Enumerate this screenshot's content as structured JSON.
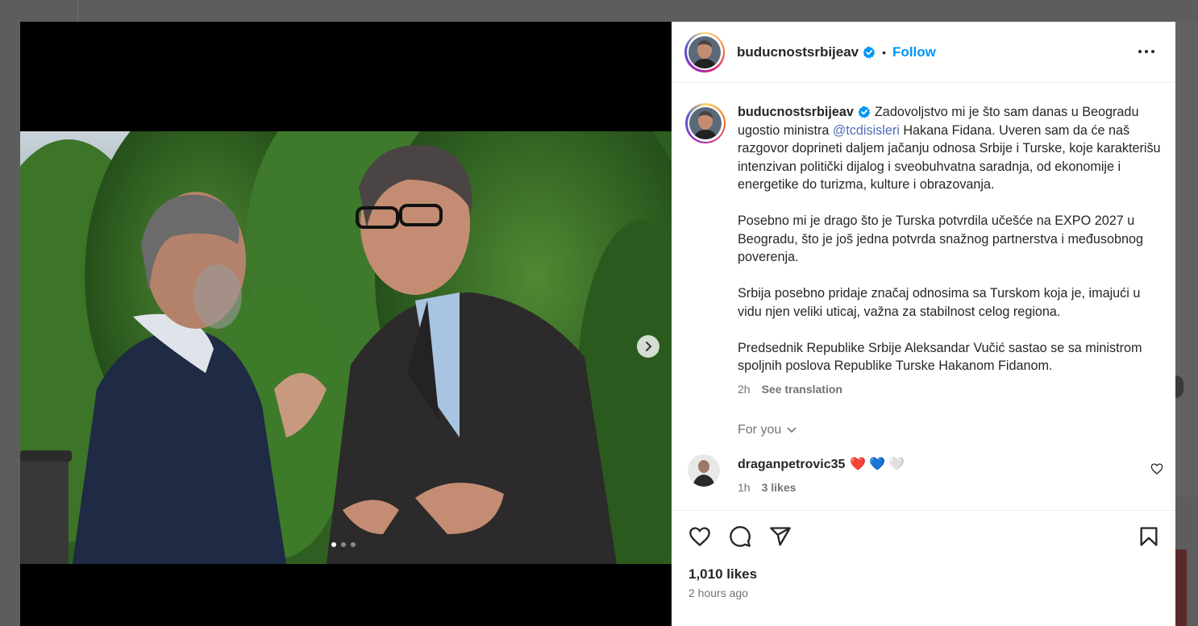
{
  "post": {
    "username": "buducnostsrbijeav",
    "separator": "•",
    "follow_label": "Follow",
    "verified_icon": "verified-badge-icon",
    "more_icon": "more-options-icon"
  },
  "caption": {
    "username": "buducnostsrbijeav",
    "p1_before": "Zadovoljstvo mi je što sam danas u Beogradu ugostio ministra ",
    "mention": "@tcdisisleri",
    "p1_after": " Hakana Fidana. Uveren sam da će naš razgovor doprineti daljem jačanju odnosa Srbije i Turske, koje karakterišu intenzivan politički dijalog i sveobuhvatna saradnja, od ekonomije i energetike do turizma, kulture i obrazovanja.",
    "p2": "Posebno mi je drago što je Turska potvrdila učešće na EXPO 2027 u Beogradu, što je još jedna potvrda snažnog partnerstva i međusobnog poverenja.",
    "p3": "Srbija posebno pridaje značaj odnosima sa Turskom koja je, imajući u vidu njen veliki uticaj, važna za stabilnost celog regiona.",
    "p4": "Predsednik Republike Srbije Aleksandar Vučić sastao se sa ministrom spoljnih poslova Republike Turske Hakanom Fidanom.",
    "time": "2h",
    "see_translation": "See translation"
  },
  "for_you": "For you",
  "comment": {
    "username": "draganpetrovic35",
    "emojis": "❤️💙🤍",
    "time": "1h",
    "likes": "3 likes"
  },
  "actions": {
    "like_icon": "heart-icon",
    "comment_icon": "comment-icon",
    "share_icon": "share-icon",
    "save_icon": "bookmark-icon"
  },
  "likes_count": "1,010 likes",
  "posted_ago": "2 hours ago",
  "carousel": {
    "total_slides": 3,
    "active_slide": 1
  },
  "colors": {
    "link": "#0095f6",
    "mention": "#4f6bb8",
    "muted": "#737373",
    "backdrop": "#5d5d5d"
  }
}
